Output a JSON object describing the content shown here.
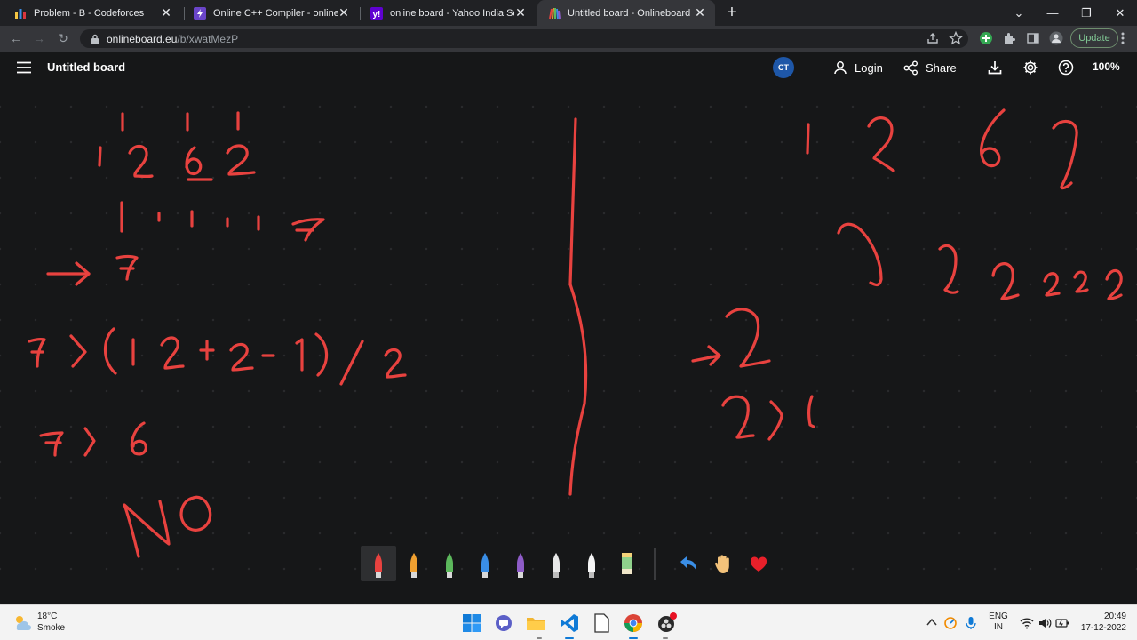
{
  "browser": {
    "tabs": [
      {
        "title": "Problem - B - Codeforces",
        "icon": "codeforces-icon",
        "active": false
      },
      {
        "title": "Online C++ Compiler - online ed",
        "icon": "compiler-icon",
        "active": false
      },
      {
        "title": "online board - Yahoo India Searc",
        "icon": "yahoo-icon",
        "active": false
      },
      {
        "title": "Untitled board - Onlineboard",
        "icon": "onlineboard-icon",
        "active": true
      }
    ],
    "url_host": "onlineboard.eu",
    "url_path": "/b/xwatMezP",
    "update_label": "Update"
  },
  "app": {
    "board_title": "Untitled board",
    "avatar_initials": "CT",
    "login_label": "Login",
    "share_label": "Share",
    "zoom": "100%"
  },
  "palette": {
    "pens": [
      {
        "name": "red-pen",
        "color": "#e8423f",
        "selected": true
      },
      {
        "name": "orange-pen",
        "color": "#f0a030",
        "selected": false
      },
      {
        "name": "green-pen",
        "color": "#5cb85c",
        "selected": false
      },
      {
        "name": "blue-pen",
        "color": "#3a8ee6",
        "selected": false
      },
      {
        "name": "purple-pen",
        "color": "#8e5cc7",
        "selected": false
      },
      {
        "name": "white-pen",
        "color": "#e8e8e8",
        "selected": false
      },
      {
        "name": "light-pen",
        "color": "#f5f5f5",
        "selected": false
      }
    ],
    "ink_color": "#e8423f"
  },
  "taskbar": {
    "temperature": "18°C",
    "condition": "Smoke",
    "lang_top": "ENG",
    "lang_bottom": "IN",
    "time": "20:49",
    "date": "17-12-2022"
  }
}
